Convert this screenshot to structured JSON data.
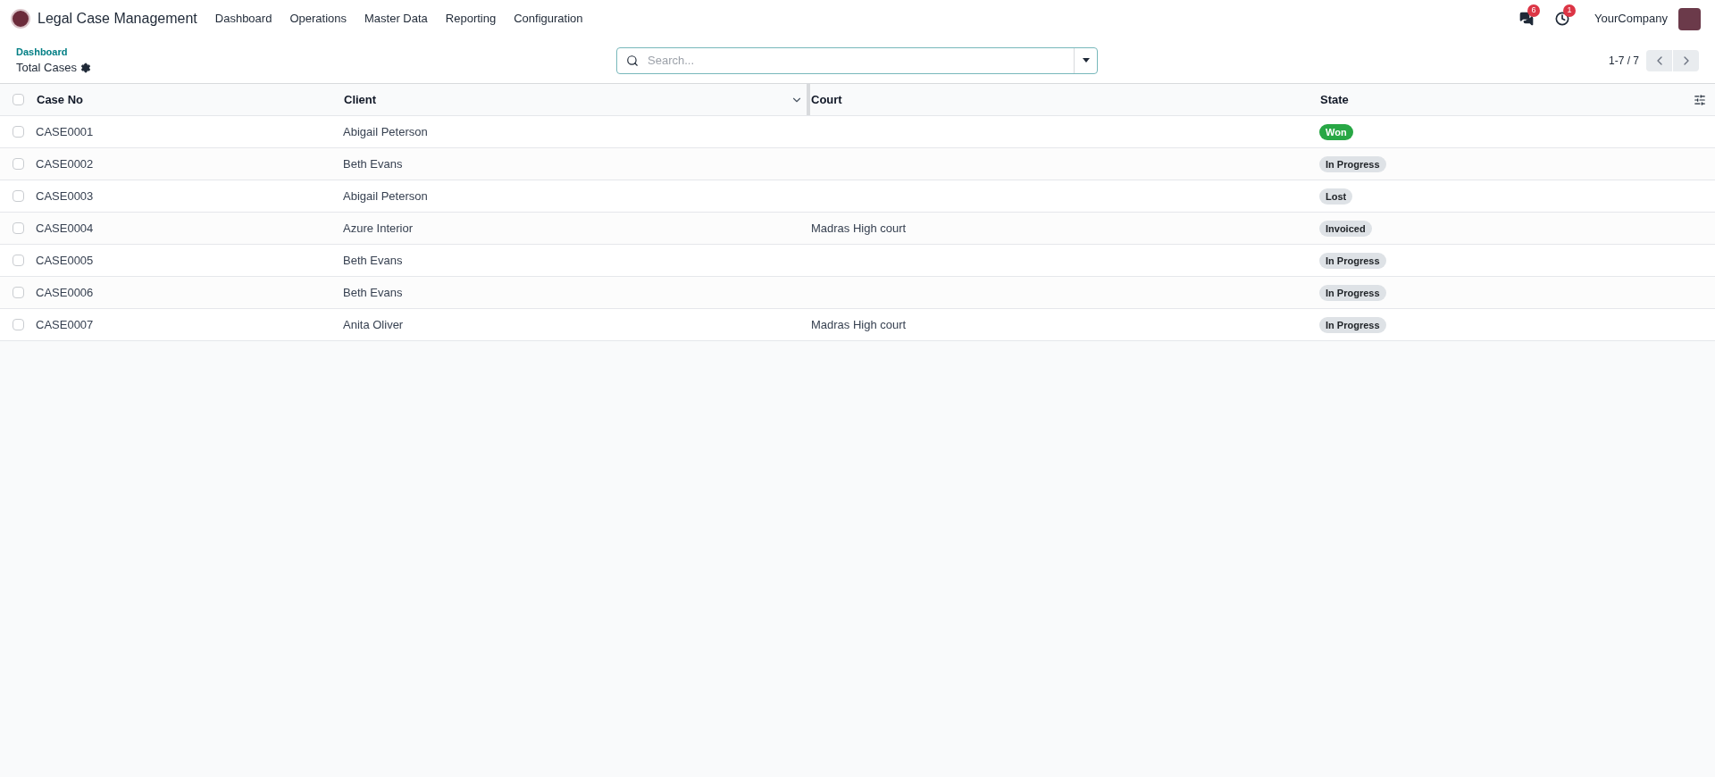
{
  "navbar": {
    "app_title": "Legal Case Management",
    "menu": [
      "Dashboard",
      "Operations",
      "Master Data",
      "Reporting",
      "Configuration"
    ],
    "messages_badge": "6",
    "activities_badge": "1",
    "company": "YourCompany"
  },
  "control_panel": {
    "breadcrumb": "Dashboard",
    "title": "Total Cases",
    "search": {
      "placeholder": "Search..."
    },
    "pager": "1-7 / 7"
  },
  "table": {
    "select_all_checked": false,
    "columns": [
      "Case No",
      "Client",
      "Court",
      "State"
    ],
    "rows": [
      {
        "checked": false,
        "case_no": "CASE0001",
        "client": "Abigail Peterson",
        "court": "",
        "state": {
          "label": "Won",
          "kind": "success"
        }
      },
      {
        "checked": false,
        "case_no": "CASE0002",
        "client": "Beth Evans",
        "court": "",
        "state": {
          "label": "In Progress",
          "kind": "neutral"
        }
      },
      {
        "checked": false,
        "case_no": "CASE0003",
        "client": "Abigail Peterson",
        "court": "",
        "state": {
          "label": "Lost",
          "kind": "neutral"
        }
      },
      {
        "checked": false,
        "case_no": "CASE0004",
        "client": "Azure Interior",
        "court": "Madras High court",
        "state": {
          "label": "Invoiced",
          "kind": "neutral"
        }
      },
      {
        "checked": false,
        "case_no": "CASE0005",
        "client": "Beth Evans",
        "court": "",
        "state": {
          "label": "In Progress",
          "kind": "neutral"
        }
      },
      {
        "checked": false,
        "case_no": "CASE0006",
        "client": "Beth Evans",
        "court": "",
        "state": {
          "label": "In Progress",
          "kind": "neutral"
        }
      },
      {
        "checked": false,
        "case_no": "CASE0007",
        "client": "Anita Oliver",
        "court": "Madras High court",
        "state": {
          "label": "In Progress",
          "kind": "neutral"
        }
      }
    ]
  }
}
